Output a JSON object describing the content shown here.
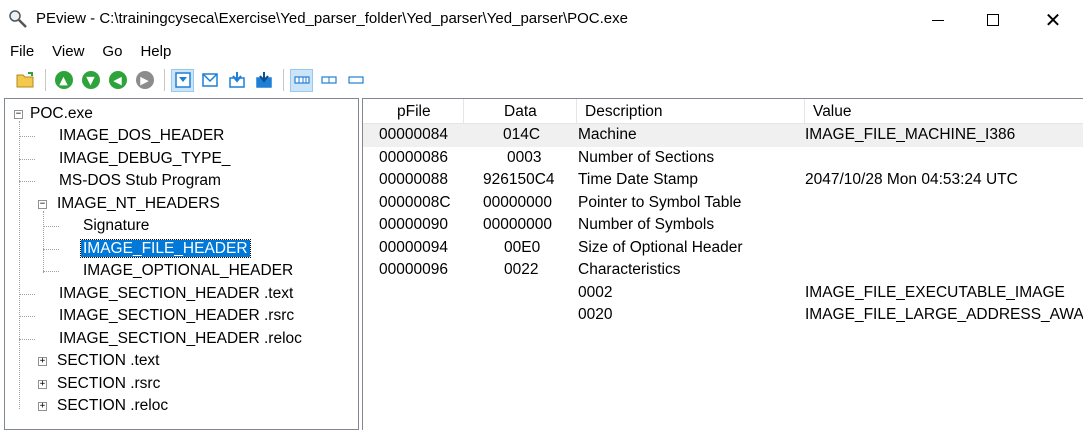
{
  "window": {
    "title": "PEview - C:\\trainingcyseca\\Exercise\\Yed_parser_folder\\Yed_parser\\Yed_parser\\POC.exe",
    "close_glyph": "✕"
  },
  "menu": [
    "File",
    "View",
    "Go",
    "Help"
  ],
  "toolbar": {
    "icons": [
      "open-folder-icon",
      "arrow-up-icon",
      "arrow-down-icon",
      "arrow-back-icon",
      "arrow-forward-icon",
      "view-byte-icon",
      "view-word-icon",
      "view-dword-icon",
      "view-qword-icon",
      "layout-wide-icon",
      "layout-medium-icon",
      "layout-narrow-icon"
    ],
    "glyphs": {
      "up": "▲",
      "down": "▼",
      "back": "◀",
      "forward": "▶"
    }
  },
  "tree": {
    "items": [
      {
        "label": "POC.exe",
        "level": 0,
        "expander": "−"
      },
      {
        "label": "IMAGE_DOS_HEADER",
        "level": 1
      },
      {
        "label": "IMAGE_DEBUG_TYPE_",
        "level": 1
      },
      {
        "label": "MS-DOS Stub Program",
        "level": 1
      },
      {
        "label": "IMAGE_NT_HEADERS",
        "level": 1,
        "expander": "−"
      },
      {
        "label": "Signature",
        "level": 2
      },
      {
        "label": "IMAGE_FILE_HEADER",
        "level": 2,
        "selected": true
      },
      {
        "label": "IMAGE_OPTIONAL_HEADER",
        "level": 2
      },
      {
        "label": "IMAGE_SECTION_HEADER .text",
        "level": 1
      },
      {
        "label": "IMAGE_SECTION_HEADER .rsrc",
        "level": 1
      },
      {
        "label": "IMAGE_SECTION_HEADER .reloc",
        "level": 1
      },
      {
        "label": "SECTION .text",
        "level": 1,
        "expander": "+"
      },
      {
        "label": "SECTION .rsrc",
        "level": 1,
        "expander": "+"
      },
      {
        "label": "SECTION .reloc",
        "level": 1,
        "expander": "+"
      }
    ]
  },
  "table": {
    "columns": [
      "pFile",
      "Data",
      "Description",
      "Value"
    ],
    "rows": [
      {
        "pfile": "00000084",
        "data": "014C",
        "description": "Machine",
        "value": "IMAGE_FILE_MACHINE_I386"
      },
      {
        "pfile": "00000086",
        "data": "0003",
        "description": "Number of Sections",
        "value": ""
      },
      {
        "pfile": "00000088",
        "data": "926150C4",
        "description": "Time Date Stamp",
        "value": "2047/10/28 Mon 04:53:24 UTC"
      },
      {
        "pfile": "0000008C",
        "data": "00000000",
        "description": "Pointer to Symbol Table",
        "value": ""
      },
      {
        "pfile": "00000090",
        "data": "00000000",
        "description": "Number of Symbols",
        "value": ""
      },
      {
        "pfile": "00000094",
        "data": "00E0",
        "description": "Size of Optional Header",
        "value": ""
      },
      {
        "pfile": "00000096",
        "data": "0022",
        "description": "Characteristics",
        "value": ""
      },
      {
        "pfile": "",
        "data": "",
        "description": "0002",
        "value": "IMAGE_FILE_EXECUTABLE_IMAGE"
      },
      {
        "pfile": "",
        "data": "",
        "description": "0020",
        "value": "IMAGE_FILE_LARGE_ADDRESS_AWARE"
      }
    ]
  },
  "colors": {
    "selection": "#0078d7",
    "toolbar_green": "#2ea33b",
    "toolbar_blue": "#1e7fd6"
  }
}
